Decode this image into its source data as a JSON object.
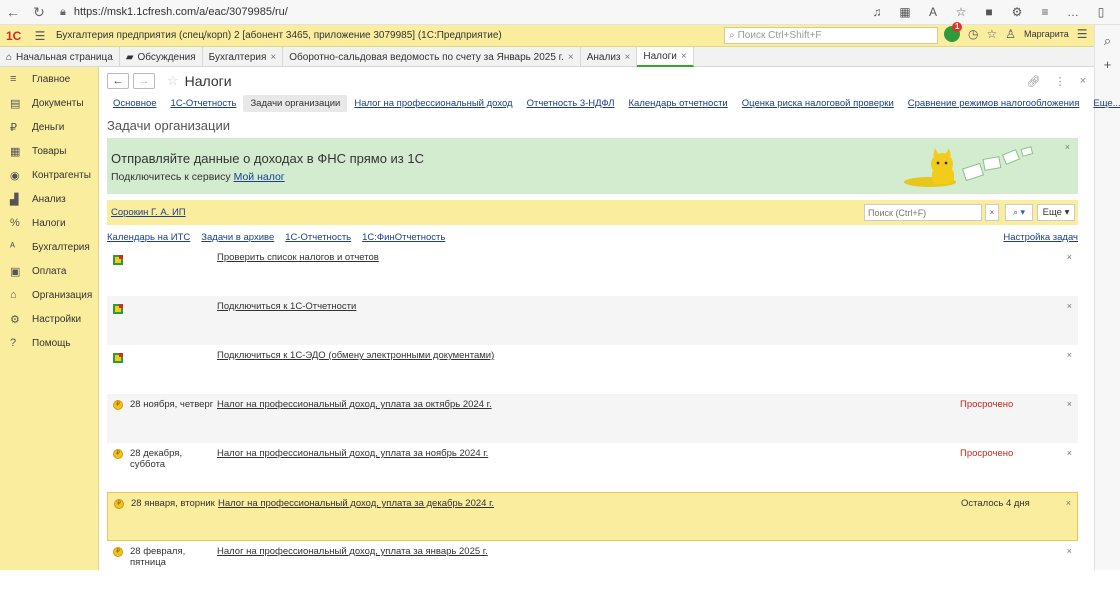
{
  "browser": {
    "url": "https://msk1.1cfresh.com/a/eac/3079985/ru/"
  },
  "app": {
    "logo": "1С",
    "title": "Бухгалтерия предприятия (спец/корп) 2 [абонент 3465, приложение 3079985]  (1С:Предприятие)",
    "search_placeholder": "Поиск Ctrl+Shift+F",
    "notifications": "1",
    "user": "Маргарита"
  },
  "tabs": [
    {
      "label": "Начальная страница",
      "closable": false
    },
    {
      "label": "Обсуждения",
      "closable": false
    },
    {
      "label": "Бухгалтерия",
      "closable": true
    },
    {
      "label": "Оборотно-сальдовая ведомость по счету за Январь 2025 г.",
      "closable": true
    },
    {
      "label": "Анализ",
      "closable": true
    },
    {
      "label": "Налоги",
      "closable": true,
      "active": true
    }
  ],
  "sidebar": {
    "items": [
      {
        "label": "Главное",
        "icon": "menu-icon"
      },
      {
        "label": "Документы",
        "icon": "document-icon"
      },
      {
        "label": "Деньги",
        "icon": "ruble-icon"
      },
      {
        "label": "Товары",
        "icon": "goods-icon"
      },
      {
        "label": "Контрагенты",
        "icon": "contacts-icon"
      },
      {
        "label": "Анализ",
        "icon": "chart-icon"
      },
      {
        "label": "Налоги",
        "icon": "percent-icon"
      },
      {
        "label": "Бухгалтерия",
        "icon": "accounting-icon"
      },
      {
        "label": "Оплата",
        "icon": "payment-icon"
      },
      {
        "label": "Организация",
        "icon": "home-icon"
      },
      {
        "label": "Настройки",
        "icon": "gear-icon"
      },
      {
        "label": "Помощь",
        "icon": "help-icon"
      }
    ]
  },
  "page": {
    "title": "Налоги",
    "section_title": "Задачи организации"
  },
  "subnav": [
    {
      "label": "Основное"
    },
    {
      "label": "1С-Отчетность"
    },
    {
      "label": "Задачи организации",
      "active": true
    },
    {
      "label": "Налог на профессиональный доход"
    },
    {
      "label": "Отчетность 3-НДФЛ"
    },
    {
      "label": "Календарь отчетности"
    },
    {
      "label": "Оценка риска налоговой проверки"
    },
    {
      "label": "Сравнение режимов налогообложения"
    },
    {
      "label": "Еще..."
    }
  ],
  "banner": {
    "heading": "Отправляйте данные о доходах в ФНС прямо из 1С",
    "text": "Подключитесь к сервису ",
    "link": "Мой налог"
  },
  "filter": {
    "organization": "Сорокин Г. А. ИП",
    "search_placeholder": "Поиск (Ctrl+F)",
    "more_label": "Еще"
  },
  "links": {
    "calendar": "Календарь на ИТС",
    "archive": "Задачи в архиве",
    "reporting": "1С-Отчетность",
    "fin_reporting": "1С:ФинОтчетность",
    "settings": "Настройка задач"
  },
  "tasks": [
    {
      "type": "service",
      "date": "",
      "title": "Проверить список налогов и отчетов",
      "status": ""
    },
    {
      "type": "service",
      "date": "",
      "title": "Подключиться к 1С-Отчетности",
      "status": ""
    },
    {
      "type": "service",
      "date": "",
      "title": "Подключиться к 1С-ЭДО (обмену электронными документами)",
      "status": ""
    },
    {
      "type": "payment",
      "date": "28 ноября, четверг",
      "title": "Налог на профессиональный доход, уплата за октябрь 2024 г.",
      "status": "Просрочено",
      "status_kind": "overdue"
    },
    {
      "type": "payment",
      "date": "28 декабря, суббота",
      "title": "Налог на профессиональный доход, уплата за ноябрь 2024 г.",
      "status": "Просрочено",
      "status_kind": "overdue"
    },
    {
      "type": "payment",
      "date": "28 января, вторник",
      "title": "Налог на профессиональный доход, уплата за декабрь 2024 г.",
      "status": "Осталось 4 дня",
      "status_kind": "left",
      "highlight": true
    },
    {
      "type": "payment",
      "date": "28 февраля, пятница",
      "title": "Налог на профессиональный доход, уплата за январь 2025 г.",
      "status": ""
    }
  ],
  "colors": {
    "accent_yellow": "#fbed9e",
    "banner_green": "#d3ecd0",
    "overdue_red": "#c4261d",
    "link_blue": "#1a3f8c"
  }
}
